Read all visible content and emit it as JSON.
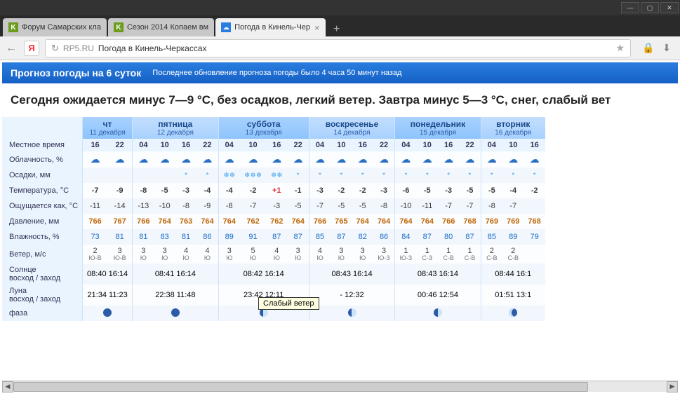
{
  "window": {
    "min": "—",
    "max": "▢",
    "close": "✕"
  },
  "tabs": [
    {
      "label": "Форум Самарских кла",
      "fav": "K"
    },
    {
      "label": "Сезон 2014 Копаем вм",
      "fav": "K"
    },
    {
      "label": "Погода в Кинель-Чер",
      "fav": "W",
      "active": true
    }
  ],
  "addr": {
    "ya": "Я",
    "domain": "RP5.RU",
    "title": "Погода в Кинель-Черкассах",
    "star": "★"
  },
  "header": {
    "title": "Прогноз погоды на 6 суток",
    "sub": "Последнее обновление прогноза погоды было 4 часа 50 минут назад"
  },
  "summary": "Сегодня ожидается минус 7—9 °С, без осадков, легкий ветер. Завтра минус 5—3 °С, снег, слабый вет",
  "rows": {
    "time": "Местное время",
    "cloud": "Облачность, %",
    "precip": "Осадки, мм",
    "temp": "Температура, °С",
    "feels": "Ощущается как, °С",
    "press": "Давление, мм",
    "hum": "Влажность, %",
    "wind": "Ветер, м/с",
    "sun": "Солнце\nвосход / заход",
    "moon_t": "Луна\nвосход / заход",
    "phase": "фаза"
  },
  "tooltip": "Слабый ветер",
  "days": [
    {
      "name": "чт",
      "date": "11 декабря",
      "cols": 2,
      "hours": [
        "16",
        "22"
      ],
      "temp": [
        "-7",
        "-9"
      ],
      "feels": [
        "-11",
        "-14"
      ],
      "press": [
        "766",
        "767"
      ],
      "hum": [
        "73",
        "81"
      ],
      "wind": [
        [
          "2",
          "Ю-В"
        ],
        [
          "3",
          "Ю-В"
        ]
      ],
      "precip": [
        "",
        ""
      ],
      "sun": "08:40   16:14",
      "moon": "21:34   11:23",
      "phase": "dark"
    },
    {
      "name": "пятница",
      "date": "12 декабря",
      "cols": 4,
      "hours": [
        "04",
        "10",
        "16",
        "22"
      ],
      "temp": [
        "-8",
        "-5",
        "-3",
        "-4"
      ],
      "feels": [
        "-13",
        "-10",
        "-8",
        "-9"
      ],
      "press": [
        "766",
        "764",
        "763",
        "764"
      ],
      "hum": [
        "81",
        "83",
        "81",
        "86"
      ],
      "wind": [
        [
          "3",
          "Ю"
        ],
        [
          "3",
          "Ю"
        ],
        [
          "4",
          "Ю"
        ],
        [
          "4",
          "Ю"
        ]
      ],
      "precip": [
        "",
        "",
        "*",
        "*"
      ],
      "sun": "08:41   16:14",
      "moon": "22:38   11:48",
      "phase": "dark"
    },
    {
      "name": "суббота",
      "date": "13 декабря",
      "cols": 4,
      "hours": [
        "04",
        "10",
        "16",
        "22"
      ],
      "temp": [
        "-4",
        "-2",
        "+1",
        "-1"
      ],
      "feels": [
        "-8",
        "-7",
        "-3",
        "-5"
      ],
      "press": [
        "764",
        "762",
        "762",
        "764"
      ],
      "hum": [
        "89",
        "91",
        "87",
        "87"
      ],
      "wind": [
        [
          "3",
          "Ю"
        ],
        [
          "5",
          "Ю"
        ],
        [
          "4",
          "Ю"
        ],
        [
          "3",
          "Ю"
        ]
      ],
      "precip": [
        "❄❄",
        "❄❄❄",
        "❄❄",
        "*"
      ],
      "sun": "08:42   16:14",
      "moon": "23:42   12:11",
      "phase": "wax"
    },
    {
      "name": "воскресенье",
      "date": "14 декабря",
      "cols": 4,
      "hours": [
        "04",
        "10",
        "16",
        "22"
      ],
      "temp": [
        "-3",
        "-2",
        "-2",
        "-3"
      ],
      "feels": [
        "-7",
        "-5",
        "-5",
        "-8"
      ],
      "press": [
        "766",
        "765",
        "764",
        "764"
      ],
      "hum": [
        "85",
        "87",
        "82",
        "86"
      ],
      "wind": [
        [
          "4",
          "Ю"
        ],
        [
          "3",
          "Ю"
        ],
        [
          "3",
          "Ю"
        ],
        [
          "3",
          "Ю-З"
        ]
      ],
      "precip": [
        "*",
        "*",
        "*",
        "*"
      ],
      "sun": "08:43   16:14",
      "moon": "-       12:32",
      "phase": "wax"
    },
    {
      "name": "понедельник",
      "date": "15 декабря",
      "cols": 4,
      "hours": [
        "04",
        "10",
        "16",
        "22"
      ],
      "temp": [
        "-6",
        "-5",
        "-3",
        "-5"
      ],
      "feels": [
        "-10",
        "-11",
        "-7",
        "-7"
      ],
      "press": [
        "764",
        "764",
        "766",
        "768"
      ],
      "hum": [
        "84",
        "87",
        "80",
        "87"
      ],
      "wind": [
        [
          "1",
          "Ю-З"
        ],
        [
          "1",
          "С-З"
        ],
        [
          "1",
          "С-В"
        ],
        [
          "1",
          "С-В"
        ]
      ],
      "precip": [
        "*",
        "*",
        "*",
        "*"
      ],
      "sun": "08:43   16:14",
      "moon": "00:46   12:54",
      "phase": "q"
    },
    {
      "name": "вторник",
      "date": "16 декабря",
      "cols": 3,
      "hours": [
        "04",
        "10",
        "16"
      ],
      "temp": [
        "-5",
        "-4",
        "-2"
      ],
      "feels": [
        "-8",
        "-7",
        ""
      ],
      "press": [
        "769",
        "769",
        "768"
      ],
      "hum": [
        "85",
        "89",
        "79"
      ],
      "wind": [
        [
          "2",
          "С-В"
        ],
        [
          "2",
          "С-В"
        ],
        [
          " ",
          " "
        ]
      ],
      "precip": [
        "*",
        "*",
        "*"
      ],
      "sun": "08:44   16:1",
      "moon": "01:51   13:1",
      "phase": "cres"
    }
  ]
}
